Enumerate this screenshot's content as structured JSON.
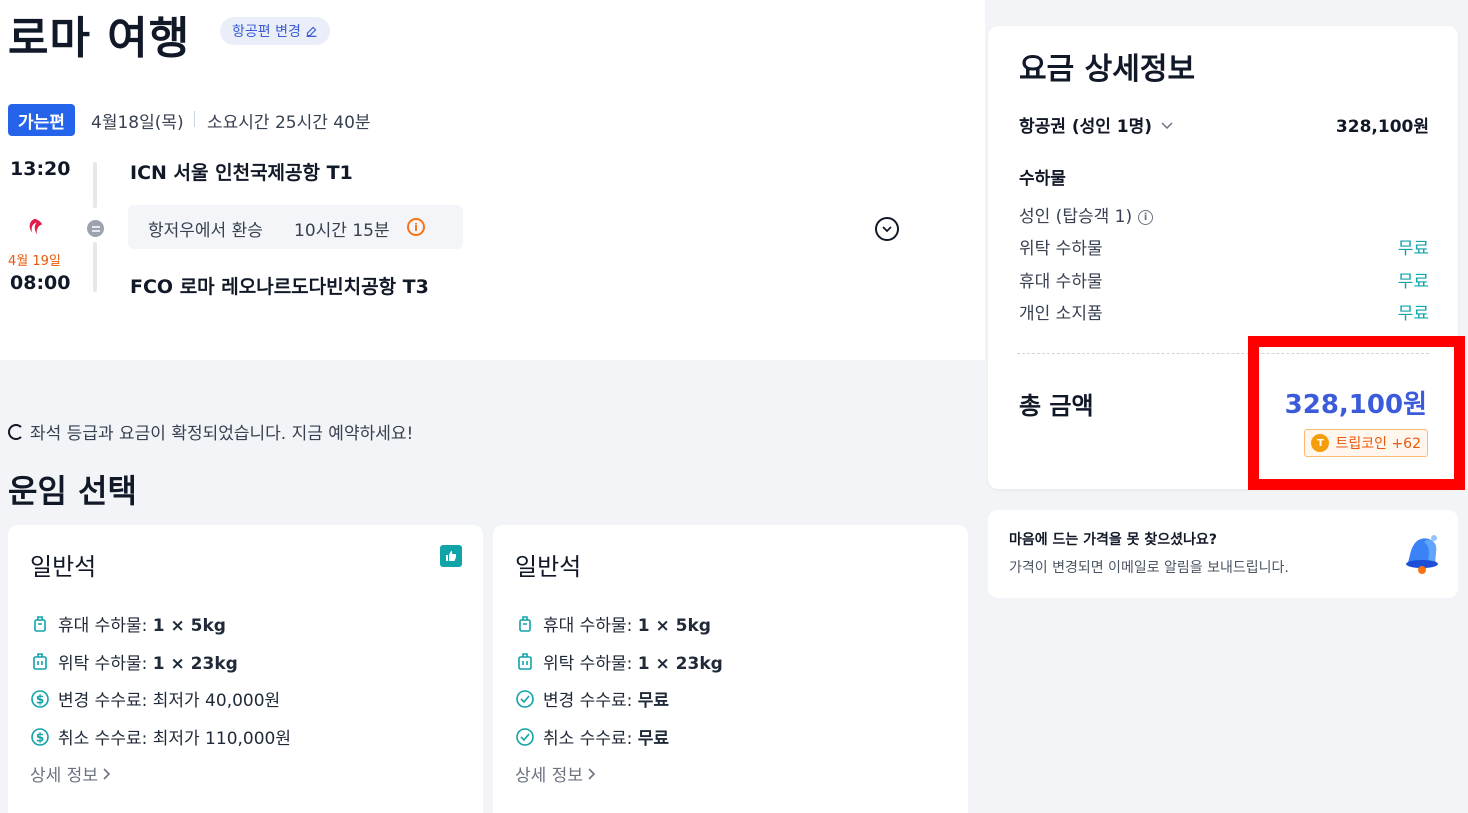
{
  "page": {
    "title": "로마 여행",
    "change_flight_label": "항공편 변경"
  },
  "itinerary": {
    "badge": "가는편",
    "date": "4월18일(목)",
    "duration": "소요시간 25시간 40분",
    "departure_time": "13:20",
    "arrival_date": "4월 19일",
    "arrival_time": "08:00",
    "departure_airport": "ICN 서울 인천국제공항 T1",
    "arrival_airport": "FCO 로마 레오나르도다빈치공항 T3",
    "transfer_city": "항저우에서 환승",
    "transfer_time": "10시간 15분",
    "info_icon": "i"
  },
  "fare_section": {
    "notice": "좌석 등급과 요금이 확정되었습니다. 지금 예약하세요!",
    "title": "운임 선택",
    "cards": [
      {
        "cabin": "일반석",
        "features": [
          {
            "label": "휴대 수하물: ",
            "value": "1 × 5kg"
          },
          {
            "label": "위탁 수하물: ",
            "value": "1 × 23kg"
          },
          {
            "label": "변경 수수료: 최저가 40,000원",
            "value": ""
          },
          {
            "label": "취소 수수료: 최저가 110,000원",
            "value": ""
          }
        ],
        "detail_link": "상세 정보"
      },
      {
        "cabin": "일반석",
        "features": [
          {
            "label": "휴대 수하물: ",
            "value": "1 × 5kg"
          },
          {
            "label": "위탁 수하물: ",
            "value": "1 × 23kg"
          },
          {
            "label": "변경 수수료: ",
            "value": "무료"
          },
          {
            "label": "취소 수수료: ",
            "value": "무료"
          }
        ],
        "detail_link": "상세 정보"
      }
    ]
  },
  "price_details": {
    "title": "요금 상세정보",
    "ticket_label": "항공권 (성인 1명)",
    "ticket_value": "328,100원",
    "baggage_title": "수하물",
    "passenger_label": "성인 (탑승객 1)",
    "passenger_info_icon": "i",
    "rows": [
      {
        "label": "위탁 수하물",
        "value": "무료"
      },
      {
        "label": "휴대 수하물",
        "value": "무료"
      },
      {
        "label": "개인 소지품",
        "value": "무료"
      }
    ],
    "total_label": "총 금액",
    "total_value": "328,100원",
    "coin_icon": "T",
    "coin_label": "트립코인 +62"
  },
  "price_alert": {
    "title": "마음에 드는 가격을 못 찾으셨나요?",
    "subtitle": "가격이 변경되면 이메일로 알림을 보내드립니다."
  },
  "colors": {
    "accent_blue": "#2563eb",
    "price_blue": "#3b5bdb",
    "teal": "#10a3a8",
    "orange": "#ea580c",
    "highlight_red": "#ff0000"
  },
  "icons": [
    "edit-icon",
    "airline-logo-icon",
    "transfer-icon",
    "info-icon",
    "chevron-down-icon",
    "spinner-icon",
    "thumbs-up-icon",
    "carry-on-bag-icon",
    "checked-bag-icon",
    "dollar-icon",
    "check-circle-icon",
    "chevron-right-icon",
    "coin-icon",
    "bell-icon"
  ]
}
